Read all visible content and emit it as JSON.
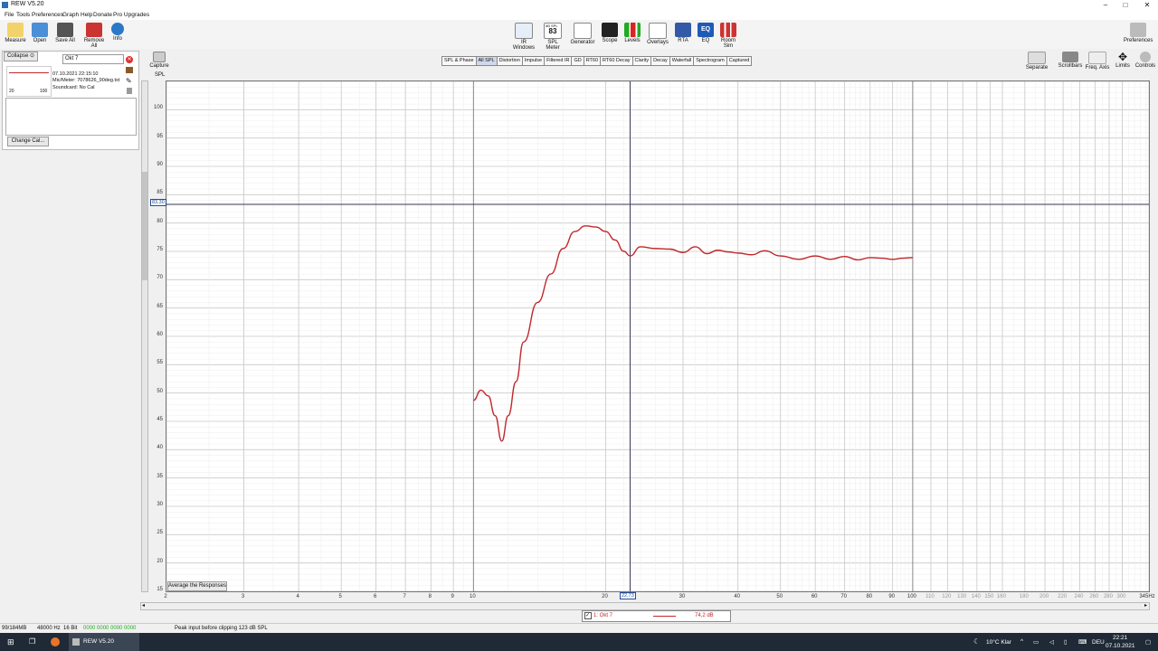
{
  "window": {
    "title": "REW V5.20"
  },
  "menu": [
    "File",
    "Tools",
    "Preferences",
    "Graph",
    "Help",
    "Donate",
    "Pro Upgrades"
  ],
  "toolbar_left": [
    {
      "label": "Measure",
      "icon": "measure-icon"
    },
    {
      "label": "Open",
      "icon": "folder-icon"
    },
    {
      "label": "Save All",
      "icon": "save-icon"
    },
    {
      "label": "Remove All",
      "icon": "remove-icon"
    },
    {
      "label": "Info",
      "icon": "info-icon"
    }
  ],
  "toolbar_center": [
    {
      "label": "IR Windows",
      "icon": "ir-windows-icon"
    },
    {
      "label": "SPL Meter",
      "icon": "spl-meter-icon",
      "value": "83",
      "sub": "dB SPL"
    },
    {
      "label": "Generator",
      "icon": "generator-icon"
    },
    {
      "label": "Scope",
      "icon": "scope-icon"
    },
    {
      "label": "Levels",
      "icon": "levels-icon"
    },
    {
      "label": "Overlays",
      "icon": "overlays-icon"
    },
    {
      "label": "RTA",
      "icon": "rta-icon"
    },
    {
      "label": "EQ",
      "icon": "eq-icon"
    },
    {
      "label": "Room Sim",
      "icon": "room-sim-icon"
    }
  ],
  "preferences_label": "Preferences",
  "right_tools": [
    "Separate",
    "Scrollbars",
    "Freq. Axis",
    "Limits",
    "Controls"
  ],
  "left_panel": {
    "collapse_label": "Collapse",
    "measurement_name": "Okt 7",
    "thumb_ticks": [
      "20",
      "100"
    ],
    "date": "07.10.2021 22:15:10",
    "mic": "Mic/Meter: 7078626_90deg.txt",
    "soundcard": "Soundcard: No Cal",
    "change_cal": "Change Cal..."
  },
  "capture_label": "Capture",
  "graph_tabs": [
    "SPL & Phase",
    "All SPL",
    "Distortion",
    "Impulse",
    "Filtered IR",
    "GD",
    "RT60",
    "RT60 Decay",
    "Clarity",
    "Decay",
    "Waterfall",
    "Spectrogram",
    "Captured"
  ],
  "active_tab": "All SPL",
  "cursor": {
    "y_readout": "83,30",
    "x_readout": "22,73"
  },
  "average_button": "Average the Responses",
  "legend": {
    "check": "1: Okt 7",
    "value": "74,2 dB",
    "color": "#c0282d"
  },
  "status": {
    "memory": "99/184MB",
    "rate": "48000 Hz",
    "bits": "16 Bit",
    "meter": "0000 0000 0000 0000",
    "peak": "Peak input before clipping 123 dB SPL"
  },
  "taskbar": {
    "app": "REW V5.20",
    "weather": "10°C  Klar",
    "lang": "DEU",
    "time": "22:21",
    "date": "07.10.2021"
  },
  "chart_data": {
    "type": "line",
    "ylabel": "SPL",
    "ylim": [
      15,
      105
    ],
    "yticks": [
      20,
      25,
      30,
      35,
      40,
      45,
      50,
      55,
      60,
      65,
      70,
      75,
      80,
      85,
      90,
      95,
      100
    ],
    "xlim": [
      2,
      345
    ],
    "xscale": "log",
    "xticks": [
      "2",
      "3",
      "4",
      "5",
      "6",
      "7",
      "8",
      "9",
      "10",
      "20",
      "30",
      "40",
      "50",
      "60",
      "70",
      "80",
      "90",
      "100",
      "110",
      "120",
      "130",
      "140",
      "150",
      "160",
      "180",
      "200",
      "220",
      "240",
      "260",
      "280",
      "300",
      "345Hz"
    ],
    "x_tick_values": [
      2,
      3,
      4,
      5,
      6,
      7,
      8,
      9,
      10,
      20,
      30,
      40,
      50,
      60,
      70,
      80,
      90,
      100,
      110,
      120,
      130,
      140,
      150,
      160,
      180,
      200,
      220,
      240,
      260,
      280,
      300,
      345
    ],
    "grid": true,
    "series": [
      {
        "name": "1: Okt 7",
        "color": "#c0282d",
        "x": [
          10,
          10.4,
          10.8,
          11.2,
          11.6,
          12,
          12.5,
          13,
          14,
          15,
          16,
          17,
          18,
          19,
          20,
          21,
          22,
          22.73,
          24,
          26,
          28,
          30,
          32,
          34,
          36,
          38,
          40,
          43,
          46,
          50,
          55,
          60,
          65,
          70,
          75,
          80,
          85,
          90,
          95,
          100
        ],
        "y": [
          48.7,
          50.5,
          49.5,
          46,
          41.5,
          46,
          52,
          59,
          66,
          71,
          75.5,
          78.5,
          79.5,
          79.3,
          78.5,
          77,
          75,
          74.2,
          75.8,
          75.5,
          75.4,
          74.8,
          75.8,
          74.6,
          75.2,
          74.9,
          74.7,
          74.4,
          75.1,
          74.2,
          73.6,
          74.2,
          73.6,
          74.1,
          73.5,
          73.9,
          73.8,
          73.6,
          73.8,
          73.9
        ]
      }
    ]
  }
}
